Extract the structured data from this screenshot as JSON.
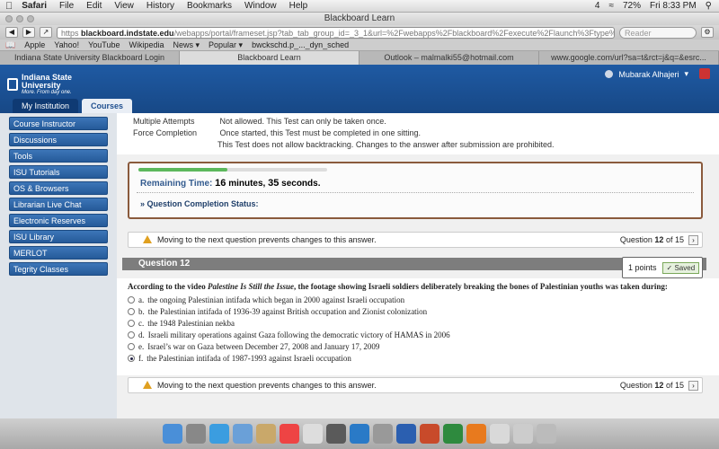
{
  "menubar": {
    "app": "Safari",
    "items": [
      "File",
      "Edit",
      "View",
      "History",
      "Bookmarks",
      "Window",
      "Help"
    ],
    "battery": "72%",
    "clock": "Fri 8:33 PM",
    "badge": "4"
  },
  "browser": {
    "window_title": "Blackboard Learn",
    "url_proto": "https",
    "url_host": "blackboard.indstate.edu",
    "url_path": "/webapps/portal/frameset.jsp?tab_tab_group_id=_3_1&url=%2Fwebapps%2Fblackboard%2Fexecute%2Flaunch%3Ftype%3DCourse%2",
    "reader_label": "Reader",
    "bookmarks": [
      "Apple",
      "Yahoo!",
      "YouTube",
      "Wikipedia",
      "News ▾",
      "Popular ▾",
      "bwckschd.p_..._dyn_sched"
    ],
    "tabs": [
      "Indiana State University Blackboard Login",
      "Blackboard Learn",
      "Outlook – malmalki55@hotmail.com",
      "www.google.com/url?sa=t&rct=j&q=&esrc..."
    ]
  },
  "bb": {
    "logo_line1": "Indiana State",
    "logo_line2": "University",
    "logo_tagline": "More. From day one.",
    "user_name": "Mubarak Alhajeri",
    "tabs": [
      "My Institution",
      "Courses"
    ]
  },
  "sidebar": {
    "items": [
      "Course Instructor",
      "Discussions",
      "Tools",
      "ISU Tutorials",
      "OS & Browsers",
      "Librarian Live Chat",
      "Electronic Reserves",
      "ISU Library",
      "MERLOT",
      "Tegrity Classes"
    ]
  },
  "test_info": {
    "multiple_label": "Multiple Attempts",
    "multiple_value": "Not allowed. This Test can only be taken once.",
    "force_label": "Force Completion",
    "force_value": "Once started, this Test must be completed in one sitting.",
    "backtrack": "This Test does not allow backtracking. Changes to the answer after submission are prohibited."
  },
  "timer": {
    "label": "Remaining Time:",
    "minutes": "16",
    "minutes_unit": "minutes,",
    "seconds": "35",
    "seconds_unit": "seconds.",
    "progress": 0.47,
    "status_label": "Question Completion Status:"
  },
  "nav": {
    "warning": "Moving to the next question prevents changes to this answer.",
    "question_word": "Question",
    "current": "12",
    "of_word": "of",
    "total": "15"
  },
  "question": {
    "title": "Question 12",
    "points": "1 points",
    "saved_label": "Saved",
    "text_before": "According to the video ",
    "text_title": "Palestine Is Still the Issue",
    "text_after": ", the footage showing Israeli soldiers deliberately breaking the bones of Palestinian youths was taken during:",
    "options": [
      {
        "letter": "a.",
        "text": "the ongoing Palestinian intifada which began in 2000 against Israeli occupation"
      },
      {
        "letter": "b.",
        "text": "the Palestinian intifada of 1936-39 against British occupation and Zionist colonization"
      },
      {
        "letter": "c.",
        "text": "the 1948 Palestinian nekba"
      },
      {
        "letter": "d.",
        "text": "Israeli military operations against Gaza following the democratic victory of HAMAS in 2006"
      },
      {
        "letter": "e.",
        "text": "Israel’s war on Gaza between December 27, 2008 and January 17, 2009"
      },
      {
        "letter": "f.",
        "text": "the Palestinian intifada of 1987-1993 against  Israeli occupation"
      }
    ],
    "selected_index": 5
  },
  "colors": {
    "bb_blue": "#1f5aa3",
    "timer_border": "#8a5a3c",
    "progress_green": "#5cb85c"
  }
}
